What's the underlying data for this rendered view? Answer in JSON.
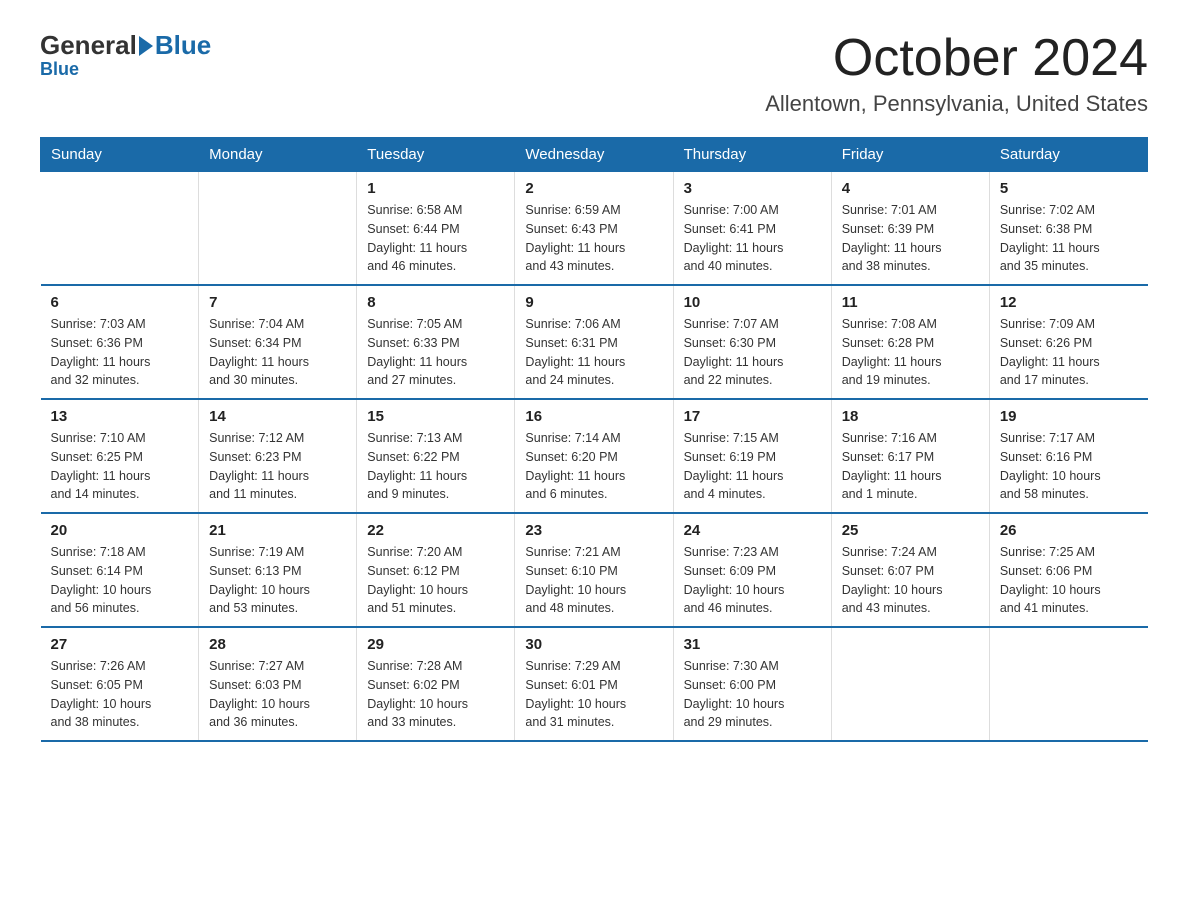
{
  "logo": {
    "general": "General",
    "blue": "Blue",
    "subtitle": "Blue"
  },
  "title": "October 2024",
  "location": "Allentown, Pennsylvania, United States",
  "days_of_week": [
    "Sunday",
    "Monday",
    "Tuesday",
    "Wednesday",
    "Thursday",
    "Friday",
    "Saturday"
  ],
  "weeks": [
    [
      {
        "day": "",
        "info": ""
      },
      {
        "day": "",
        "info": ""
      },
      {
        "day": "1",
        "info": "Sunrise: 6:58 AM\nSunset: 6:44 PM\nDaylight: 11 hours\nand 46 minutes."
      },
      {
        "day": "2",
        "info": "Sunrise: 6:59 AM\nSunset: 6:43 PM\nDaylight: 11 hours\nand 43 minutes."
      },
      {
        "day": "3",
        "info": "Sunrise: 7:00 AM\nSunset: 6:41 PM\nDaylight: 11 hours\nand 40 minutes."
      },
      {
        "day": "4",
        "info": "Sunrise: 7:01 AM\nSunset: 6:39 PM\nDaylight: 11 hours\nand 38 minutes."
      },
      {
        "day": "5",
        "info": "Sunrise: 7:02 AM\nSunset: 6:38 PM\nDaylight: 11 hours\nand 35 minutes."
      }
    ],
    [
      {
        "day": "6",
        "info": "Sunrise: 7:03 AM\nSunset: 6:36 PM\nDaylight: 11 hours\nand 32 minutes."
      },
      {
        "day": "7",
        "info": "Sunrise: 7:04 AM\nSunset: 6:34 PM\nDaylight: 11 hours\nand 30 minutes."
      },
      {
        "day": "8",
        "info": "Sunrise: 7:05 AM\nSunset: 6:33 PM\nDaylight: 11 hours\nand 27 minutes."
      },
      {
        "day": "9",
        "info": "Sunrise: 7:06 AM\nSunset: 6:31 PM\nDaylight: 11 hours\nand 24 minutes."
      },
      {
        "day": "10",
        "info": "Sunrise: 7:07 AM\nSunset: 6:30 PM\nDaylight: 11 hours\nand 22 minutes."
      },
      {
        "day": "11",
        "info": "Sunrise: 7:08 AM\nSunset: 6:28 PM\nDaylight: 11 hours\nand 19 minutes."
      },
      {
        "day": "12",
        "info": "Sunrise: 7:09 AM\nSunset: 6:26 PM\nDaylight: 11 hours\nand 17 minutes."
      }
    ],
    [
      {
        "day": "13",
        "info": "Sunrise: 7:10 AM\nSunset: 6:25 PM\nDaylight: 11 hours\nand 14 minutes."
      },
      {
        "day": "14",
        "info": "Sunrise: 7:12 AM\nSunset: 6:23 PM\nDaylight: 11 hours\nand 11 minutes."
      },
      {
        "day": "15",
        "info": "Sunrise: 7:13 AM\nSunset: 6:22 PM\nDaylight: 11 hours\nand 9 minutes."
      },
      {
        "day": "16",
        "info": "Sunrise: 7:14 AM\nSunset: 6:20 PM\nDaylight: 11 hours\nand 6 minutes."
      },
      {
        "day": "17",
        "info": "Sunrise: 7:15 AM\nSunset: 6:19 PM\nDaylight: 11 hours\nand 4 minutes."
      },
      {
        "day": "18",
        "info": "Sunrise: 7:16 AM\nSunset: 6:17 PM\nDaylight: 11 hours\nand 1 minute."
      },
      {
        "day": "19",
        "info": "Sunrise: 7:17 AM\nSunset: 6:16 PM\nDaylight: 10 hours\nand 58 minutes."
      }
    ],
    [
      {
        "day": "20",
        "info": "Sunrise: 7:18 AM\nSunset: 6:14 PM\nDaylight: 10 hours\nand 56 minutes."
      },
      {
        "day": "21",
        "info": "Sunrise: 7:19 AM\nSunset: 6:13 PM\nDaylight: 10 hours\nand 53 minutes."
      },
      {
        "day": "22",
        "info": "Sunrise: 7:20 AM\nSunset: 6:12 PM\nDaylight: 10 hours\nand 51 minutes."
      },
      {
        "day": "23",
        "info": "Sunrise: 7:21 AM\nSunset: 6:10 PM\nDaylight: 10 hours\nand 48 minutes."
      },
      {
        "day": "24",
        "info": "Sunrise: 7:23 AM\nSunset: 6:09 PM\nDaylight: 10 hours\nand 46 minutes."
      },
      {
        "day": "25",
        "info": "Sunrise: 7:24 AM\nSunset: 6:07 PM\nDaylight: 10 hours\nand 43 minutes."
      },
      {
        "day": "26",
        "info": "Sunrise: 7:25 AM\nSunset: 6:06 PM\nDaylight: 10 hours\nand 41 minutes."
      }
    ],
    [
      {
        "day": "27",
        "info": "Sunrise: 7:26 AM\nSunset: 6:05 PM\nDaylight: 10 hours\nand 38 minutes."
      },
      {
        "day": "28",
        "info": "Sunrise: 7:27 AM\nSunset: 6:03 PM\nDaylight: 10 hours\nand 36 minutes."
      },
      {
        "day": "29",
        "info": "Sunrise: 7:28 AM\nSunset: 6:02 PM\nDaylight: 10 hours\nand 33 minutes."
      },
      {
        "day": "30",
        "info": "Sunrise: 7:29 AM\nSunset: 6:01 PM\nDaylight: 10 hours\nand 31 minutes."
      },
      {
        "day": "31",
        "info": "Sunrise: 7:30 AM\nSunset: 6:00 PM\nDaylight: 10 hours\nand 29 minutes."
      },
      {
        "day": "",
        "info": ""
      },
      {
        "day": "",
        "info": ""
      }
    ]
  ]
}
